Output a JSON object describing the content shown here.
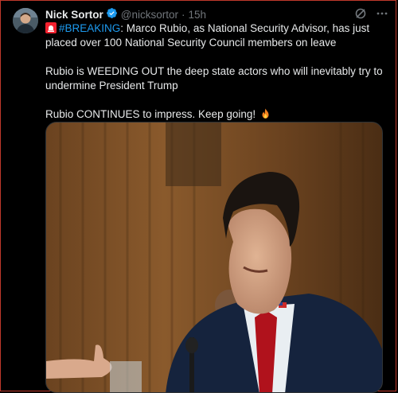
{
  "tweet": {
    "author_name": "Nick Sortor",
    "handle": "@nicksortor",
    "separator": "·",
    "time": "15h",
    "icons": {
      "avatar": "avatar",
      "verified": "verified-badge-icon",
      "grok": "grok-icon",
      "more": "more-icon",
      "siren": "rotating-light-emoji",
      "fire": "fire-emoji"
    },
    "line1": {
      "hashtag": "#BREAKING",
      "rest": ": Marco Rubio, as National Security Advisor, has just placed over 100 National Security Council members on leave"
    },
    "line2": "Rubio is WEEDING OUT the deep state actors who will inevitably try to undermine President Trump",
    "line3": "Rubio CONTINUES to impress. Keep going!",
    "colors": {
      "background": "#000000",
      "text": "#e7e9ea",
      "muted": "#71767b",
      "link": "#1d9bf0",
      "verified": "#1d9bf0"
    }
  }
}
